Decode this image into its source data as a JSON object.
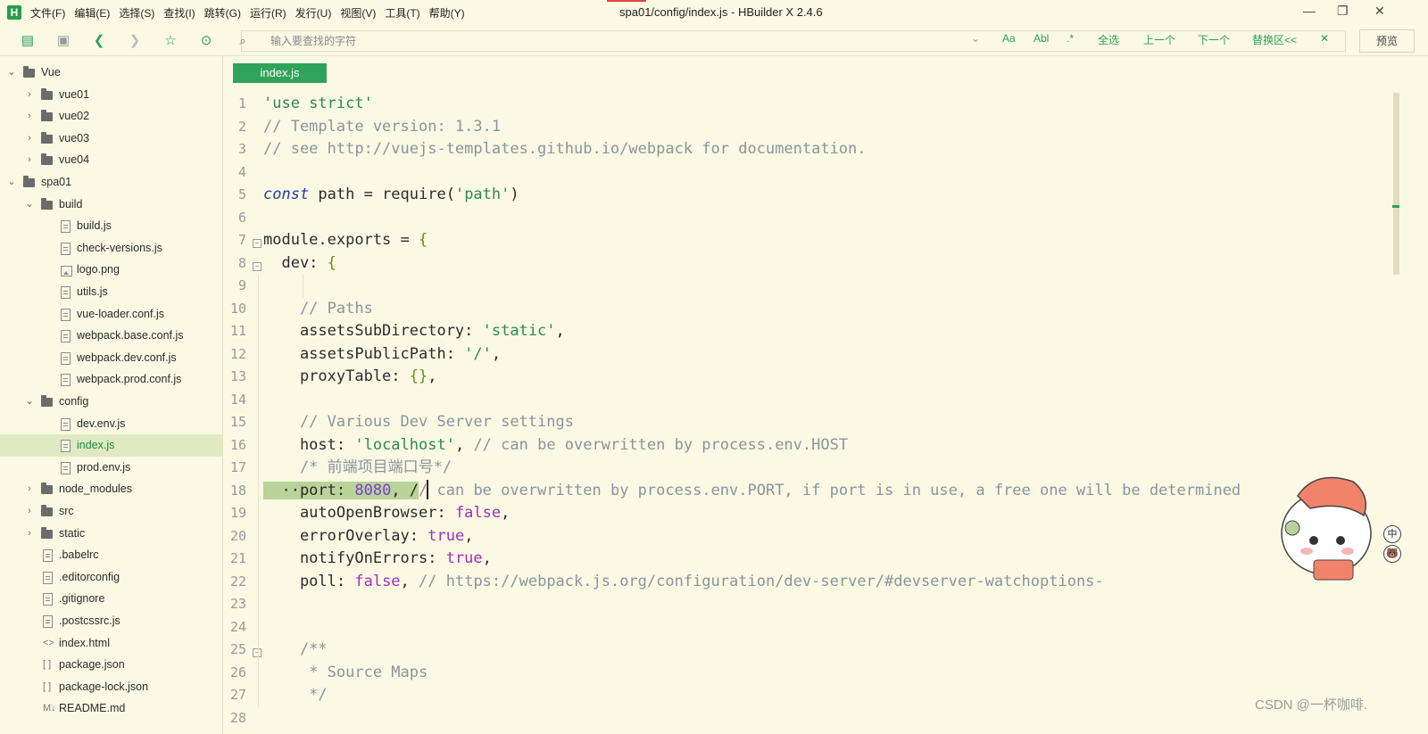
{
  "window": {
    "title": "spa01/config/index.js - HBuilder X 2.4.6",
    "app_logo": "H",
    "controls": [
      "—",
      "❐",
      "✕"
    ]
  },
  "menu": [
    "文件(F)",
    "编辑(E)",
    "选择(S)",
    "查找(I)",
    "跳转(G)",
    "运行(R)",
    "发行(U)",
    "视图(V)",
    "工具(T)",
    "帮助(Y)"
  ],
  "toolbar": {
    "icons": [
      "new-file-icon",
      "save-icon",
      "back-icon",
      "forward-icon",
      "star-icon",
      "run-icon",
      "find-icon"
    ],
    "search_placeholder": "输入要查找的字符",
    "options": {
      "match_case": "Aa",
      "whole_word": "Abl",
      "regex": ".*",
      "select_all": "全选",
      "prev": "上一个",
      "next": "下一个",
      "replace": "替换区<<",
      "close": "✕"
    },
    "preview_label": "预览"
  },
  "tree": [
    {
      "label": "Vue",
      "type": "folder",
      "depth": 0,
      "expanded": true
    },
    {
      "label": "vue01",
      "type": "folder",
      "depth": 1,
      "expanded": false
    },
    {
      "label": "vue02",
      "type": "folder",
      "depth": 1,
      "expanded": false
    },
    {
      "label": "vue03",
      "type": "folder",
      "depth": 1,
      "expanded": false
    },
    {
      "label": "vue04",
      "type": "folder",
      "depth": 1,
      "expanded": false
    },
    {
      "label": "spa01",
      "type": "folder",
      "depth": 0,
      "expanded": true
    },
    {
      "label": "build",
      "type": "folder",
      "depth": 1,
      "expanded": true
    },
    {
      "label": "build.js",
      "type": "file",
      "depth": 2
    },
    {
      "label": "check-versions.js",
      "type": "file",
      "depth": 2
    },
    {
      "label": "logo.png",
      "type": "image",
      "depth": 2
    },
    {
      "label": "utils.js",
      "type": "file",
      "depth": 2
    },
    {
      "label": "vue-loader.conf.js",
      "type": "file",
      "depth": 2
    },
    {
      "label": "webpack.base.conf.js",
      "type": "file",
      "depth": 2
    },
    {
      "label": "webpack.dev.conf.js",
      "type": "file",
      "depth": 2
    },
    {
      "label": "webpack.prod.conf.js",
      "type": "file",
      "depth": 2
    },
    {
      "label": "config",
      "type": "folder",
      "depth": 1,
      "expanded": true
    },
    {
      "label": "dev.env.js",
      "type": "file",
      "depth": 2
    },
    {
      "label": "index.js",
      "type": "file",
      "depth": 2,
      "selected": true
    },
    {
      "label": "prod.env.js",
      "type": "file",
      "depth": 2
    },
    {
      "label": "node_modules",
      "type": "folder",
      "depth": 1,
      "expanded": false
    },
    {
      "label": "src",
      "type": "folder",
      "depth": 1,
      "expanded": false
    },
    {
      "label": "static",
      "type": "folder",
      "depth": 1,
      "expanded": false
    },
    {
      "label": ".babelrc",
      "type": "plain",
      "depth": 1
    },
    {
      "label": ".editorconfig",
      "type": "plain",
      "depth": 1
    },
    {
      "label": ".gitignore",
      "type": "plain",
      "depth": 1
    },
    {
      "label": ".postcssrc.js",
      "type": "file",
      "depth": 1
    },
    {
      "label": "index.html",
      "type": "html",
      "depth": 1
    },
    {
      "label": "package.json",
      "type": "json",
      "depth": 1
    },
    {
      "label": "package-lock.json",
      "type": "json",
      "depth": 1
    },
    {
      "label": "README.md",
      "type": "md",
      "depth": 1
    }
  ],
  "editor": {
    "tab_label": "index.js",
    "line_numbers": [
      "1",
      "2",
      "3",
      "4",
      "5",
      "6",
      "7",
      "8",
      "9",
      "10",
      "11",
      "12",
      "13",
      "14",
      "15",
      "16",
      "17",
      "18",
      "19",
      "20",
      "21",
      "22",
      "23",
      "24",
      "25",
      "26",
      "27",
      "28"
    ],
    "fold_marks": [
      "⊟",
      "⊟",
      "⊟"
    ],
    "lines": [
      [
        {
          "t": "'use strict'",
          "c": "str"
        }
      ],
      [
        {
          "t": "// Template version: 1.3.1",
          "c": "cmt"
        }
      ],
      [
        {
          "t": "// see http://vuejs-templates.github.io/webpack for documentation.",
          "c": "cmt"
        }
      ],
      [],
      [
        {
          "t": "const",
          "c": "kw"
        },
        {
          "t": " path = require(",
          "c": "punc"
        },
        {
          "t": "'path'",
          "c": "str"
        },
        {
          "t": ")",
          "c": "punc"
        }
      ],
      [],
      [
        {
          "t": "module.exports = ",
          "c": "punc"
        },
        {
          "t": "{",
          "c": "brk"
        }
      ],
      [
        {
          "t": "  dev: ",
          "c": "punc"
        },
        {
          "t": "{",
          "c": "brk"
        }
      ],
      [],
      [
        {
          "t": "    // Paths",
          "c": "cmt"
        }
      ],
      [
        {
          "t": "    assetsSubDirectory: ",
          "c": "punc"
        },
        {
          "t": "'static'",
          "c": "str"
        },
        {
          "t": ",",
          "c": "punc"
        }
      ],
      [
        {
          "t": "    assetsPublicPath: ",
          "c": "punc"
        },
        {
          "t": "'/'",
          "c": "str"
        },
        {
          "t": ",",
          "c": "punc"
        }
      ],
      [
        {
          "t": "    proxyTable: ",
          "c": "punc"
        },
        {
          "t": "{}",
          "c": "brk"
        },
        {
          "t": ",",
          "c": "punc"
        }
      ],
      [],
      [
        {
          "t": "    // Various Dev Server settings",
          "c": "cmt"
        }
      ],
      [
        {
          "t": "    host: ",
          "c": "punc"
        },
        {
          "t": "'localhost'",
          "c": "str"
        },
        {
          "t": ", ",
          "c": "punc"
        },
        {
          "t": "// can be overwritten by process.env.HOST",
          "c": "cmt"
        }
      ],
      [
        {
          "t": "    /* 前端项目端口号*/",
          "c": "cmt"
        }
      ],
      [
        {
          "t": "  ··port: ",
          "c": "hl"
        },
        {
          "t": "8080",
          "c": "hlnum"
        },
        {
          "t": ", /",
          "c": "hl"
        },
        {
          "t": "/ can be overwritten by process.env.PORT, if port is in use, a free one will be determined",
          "c": "cmt"
        }
      ],
      [
        {
          "t": "    autoOpenBrowser: ",
          "c": "punc"
        },
        {
          "t": "false",
          "c": "bool"
        },
        {
          "t": ",",
          "c": "punc"
        }
      ],
      [
        {
          "t": "    errorOverlay: ",
          "c": "punc"
        },
        {
          "t": "true",
          "c": "bool"
        },
        {
          "t": ",",
          "c": "punc"
        }
      ],
      [
        {
          "t": "    notifyOnErrors: ",
          "c": "punc"
        },
        {
          "t": "true",
          "c": "bool"
        },
        {
          "t": ",",
          "c": "punc"
        }
      ],
      [
        {
          "t": "    poll: ",
          "c": "punc"
        },
        {
          "t": "false",
          "c": "bool"
        },
        {
          "t": ", ",
          "c": "punc"
        },
        {
          "t": "// https://webpack.js.org/configuration/dev-server/#devserver-watchoptions-",
          "c": "cmt"
        }
      ],
      [],
      [],
      [
        {
          "t": "    /**",
          "c": "cmt"
        }
      ],
      [
        {
          "t": "     * Source Maps",
          "c": "cmt"
        }
      ],
      [
        {
          "t": "     */",
          "c": "cmt"
        }
      ],
      []
    ]
  },
  "ime": {
    "mode": "中",
    "emoji": "🐻"
  },
  "watermark": "CSDN @一杯咖啡."
}
